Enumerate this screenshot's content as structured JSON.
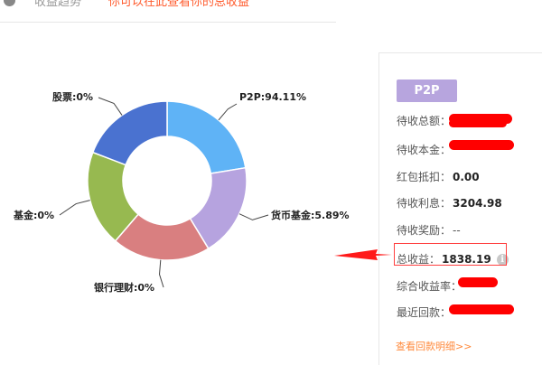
{
  "header": {
    "title": "收益趋势",
    "link": "你可以在此查看你的总收益"
  },
  "chart_data": {
    "type": "pie",
    "donut": true,
    "categories": [
      "P2P",
      "货币基金",
      "银行理财",
      "基金",
      "股票"
    ],
    "values": [
      94.11,
      5.89,
      0,
      0,
      0
    ],
    "labels": [
      "P2P:94.11%",
      "货币基金:5.89%",
      "银行理财:0%",
      "基金:0%",
      "股票:0%"
    ],
    "colors": [
      "#5fb3f6",
      "#b6a3df",
      "#d97f80",
      "#97b950",
      "#4a72d0"
    ]
  },
  "panel": {
    "badge": "P2P",
    "rows": [
      {
        "label": "待收总额：",
        "value": ""
      },
      {
        "label": "待收本金：",
        "value": ""
      },
      {
        "label": "红包抵扣：",
        "value": "0.00"
      },
      {
        "label": "待收利息：",
        "value": "3204.98"
      },
      {
        "label": "待收奖励：",
        "value": "--"
      },
      {
        "label": "总收益：",
        "value": "1838.19"
      },
      {
        "label": "综合收益率：",
        "value": ""
      },
      {
        "label": "最近回款：",
        "value": ""
      }
    ],
    "detail_link": "查看回款明细>>",
    "info_icon": "i"
  },
  "colors": {
    "redaction": "#ff0000",
    "highlight": "#ff4040",
    "link": "#ff8a3c"
  }
}
